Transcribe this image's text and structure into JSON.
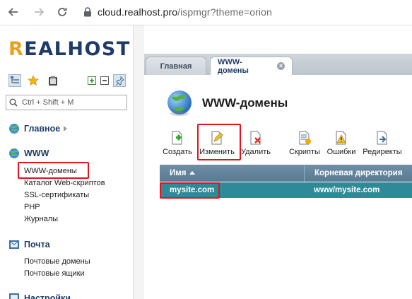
{
  "browser": {
    "url_host": "cloud.realhost.pro",
    "url_path": "/ispmgr?theme=orion"
  },
  "logo": {
    "first": "R",
    "rest": "EALHOST"
  },
  "sidebar": {
    "search_placeholder": "Ctrl + Shift + M",
    "groups": [
      {
        "title": "Главное",
        "items": []
      },
      {
        "title": "WWW",
        "items": [
          "WWW-домены",
          "Каталог Web-скриптов",
          "SSL-сертификаты",
          "PHP",
          "Журналы"
        ]
      },
      {
        "title": "Почта",
        "items": [
          "Почтовые домены",
          "Почтовые ящики"
        ]
      },
      {
        "title": "Настройки",
        "items": []
      }
    ]
  },
  "tabs": [
    {
      "label": "Главная"
    },
    {
      "label": "WWW-домены"
    }
  ],
  "page": {
    "title": "WWW-домены"
  },
  "toolbar": {
    "buttons": [
      "Создать",
      "Изменить",
      "Удалить",
      "Скрипты",
      "Ошибки",
      "Редиректы"
    ]
  },
  "table": {
    "columns": [
      "Имя",
      "Корневая директория"
    ],
    "rows": [
      {
        "name": "mysite.com",
        "root": "www/mysite.com"
      }
    ]
  },
  "colors": {
    "brand_dark": "#1f3c68",
    "brand_accent": "#e6a21a",
    "table_header": "#587a92",
    "selected_row": "#2e8a96",
    "highlight": "#e0141c"
  }
}
